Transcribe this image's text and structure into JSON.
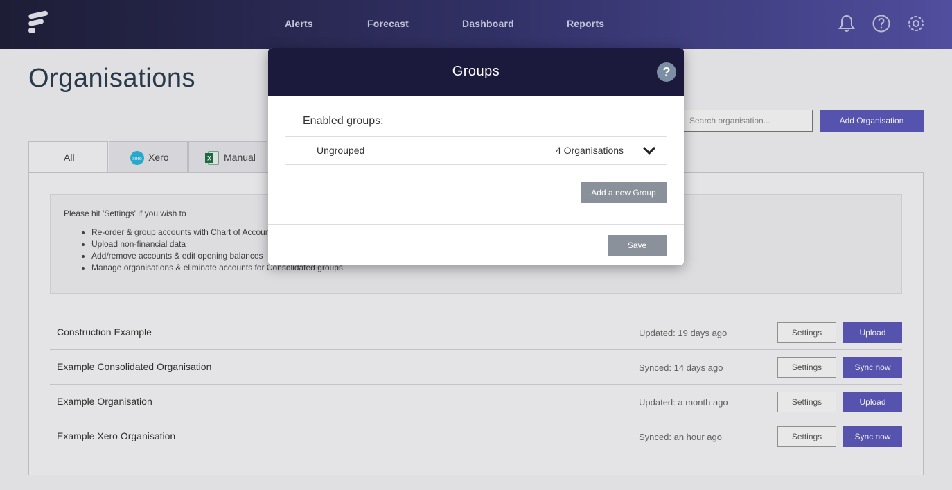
{
  "header": {
    "nav": [
      {
        "label": "Alerts"
      },
      {
        "label": "Forecast"
      },
      {
        "label": "Dashboard"
      },
      {
        "label": "Reports"
      }
    ],
    "icons": [
      "bell-icon",
      "help-circle-icon",
      "gear-icon"
    ],
    "colors": {
      "gradient_start": "#1f1f3a",
      "gradient_end": "#5553a8"
    }
  },
  "page": {
    "title": "Organisations",
    "search_placeholder": "Search organisation...",
    "add_button": "Add Organisation"
  },
  "tabs": [
    {
      "label": "All",
      "active": true
    },
    {
      "label": "Xero",
      "icon": "xero-icon"
    },
    {
      "label": "Manual",
      "icon": "excel-icon"
    }
  ],
  "info": {
    "intro": "Please hit 'Settings' if you wish to",
    "items": [
      "Re-order & group accounts with Chart of Accounts",
      "Upload non-financial data",
      "Add/remove accounts & edit opening balances",
      "Manage organisations & eliminate accounts for Consolidated groups"
    ]
  },
  "organisations": [
    {
      "name": "Construction Example",
      "status": "Updated: 19 days ago",
      "settings": "Settings",
      "action": "Upload"
    },
    {
      "name": "Example Consolidated Organisation",
      "status": "Synced: 14 days ago",
      "settings": "Settings",
      "action": "Sync now"
    },
    {
      "name": "Example Organisation",
      "status": "Updated: a month ago",
      "settings": "Settings",
      "action": "Upload"
    },
    {
      "name": "Example Xero Organisation",
      "status": "Synced: an hour ago",
      "settings": "Settings",
      "action": "Sync now"
    }
  ],
  "modal": {
    "title": "Groups",
    "help": "?",
    "enabled_label": "Enabled groups:",
    "groups": [
      {
        "name": "Ungrouped",
        "count": "4 Organisations"
      }
    ],
    "add_group": "Add a new Group",
    "save": "Save"
  },
  "colors": {
    "accent": "#5b59b9",
    "modal_header": "#1b1a3d",
    "muted_button": "#8a919b"
  }
}
